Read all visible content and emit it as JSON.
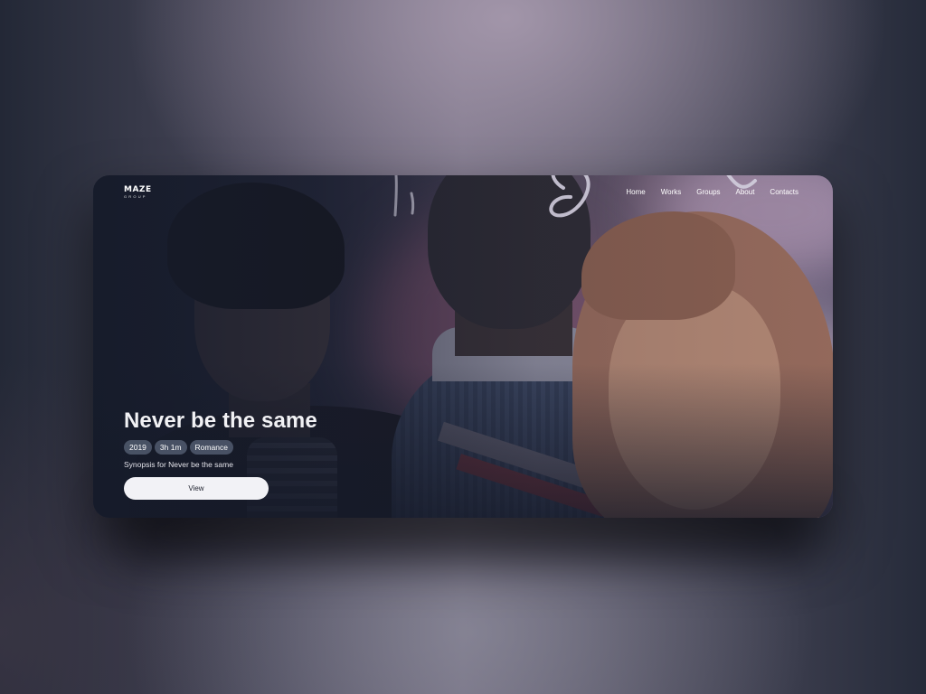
{
  "brand": {
    "name": "MAZE",
    "subtitle": "GROUP"
  },
  "nav": {
    "items": [
      {
        "label": "Home"
      },
      {
        "label": "Works"
      },
      {
        "label": "Groups"
      },
      {
        "label": "About"
      },
      {
        "label": "Contacts"
      }
    ]
  },
  "hero": {
    "title": "Never be the same",
    "tags": [
      {
        "label": "2019"
      },
      {
        "label": "3h 1m"
      },
      {
        "label": "Romance"
      }
    ],
    "synopsis": "Synopsis for Never be the same",
    "view_label": "View"
  },
  "colors": {
    "card_overlay": "#161b2a",
    "button_bg": "#f2f2f6",
    "tag_bg": "#5a6478"
  }
}
